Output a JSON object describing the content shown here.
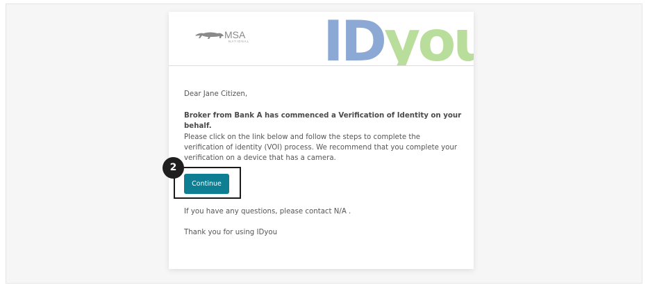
{
  "header": {
    "msa_logo": {
      "name": "MSA",
      "subtitle": "NATIONAL"
    },
    "idyou_logo": {
      "id_part": "ID",
      "you_part": "you"
    }
  },
  "email": {
    "greeting": "Dear Jane Citizen,",
    "headline": "Broker from Bank A has commenced a Verification of Identity on your behalf.",
    "instructions": "Please click on the link below and follow the steps to complete the verification of identity (VOI) process. We recommend that you complete your verification on a device that has a camera.",
    "continue_label": "Continue",
    "questions": "If you have any questions, please contact N/A .",
    "thanks": "Thank you for using IDyou"
  },
  "annotation": {
    "step_number": "2"
  },
  "colors": {
    "button": "#0e7f93",
    "id_blue": "#8ba9d4",
    "you_green": "#b9dd9a"
  }
}
